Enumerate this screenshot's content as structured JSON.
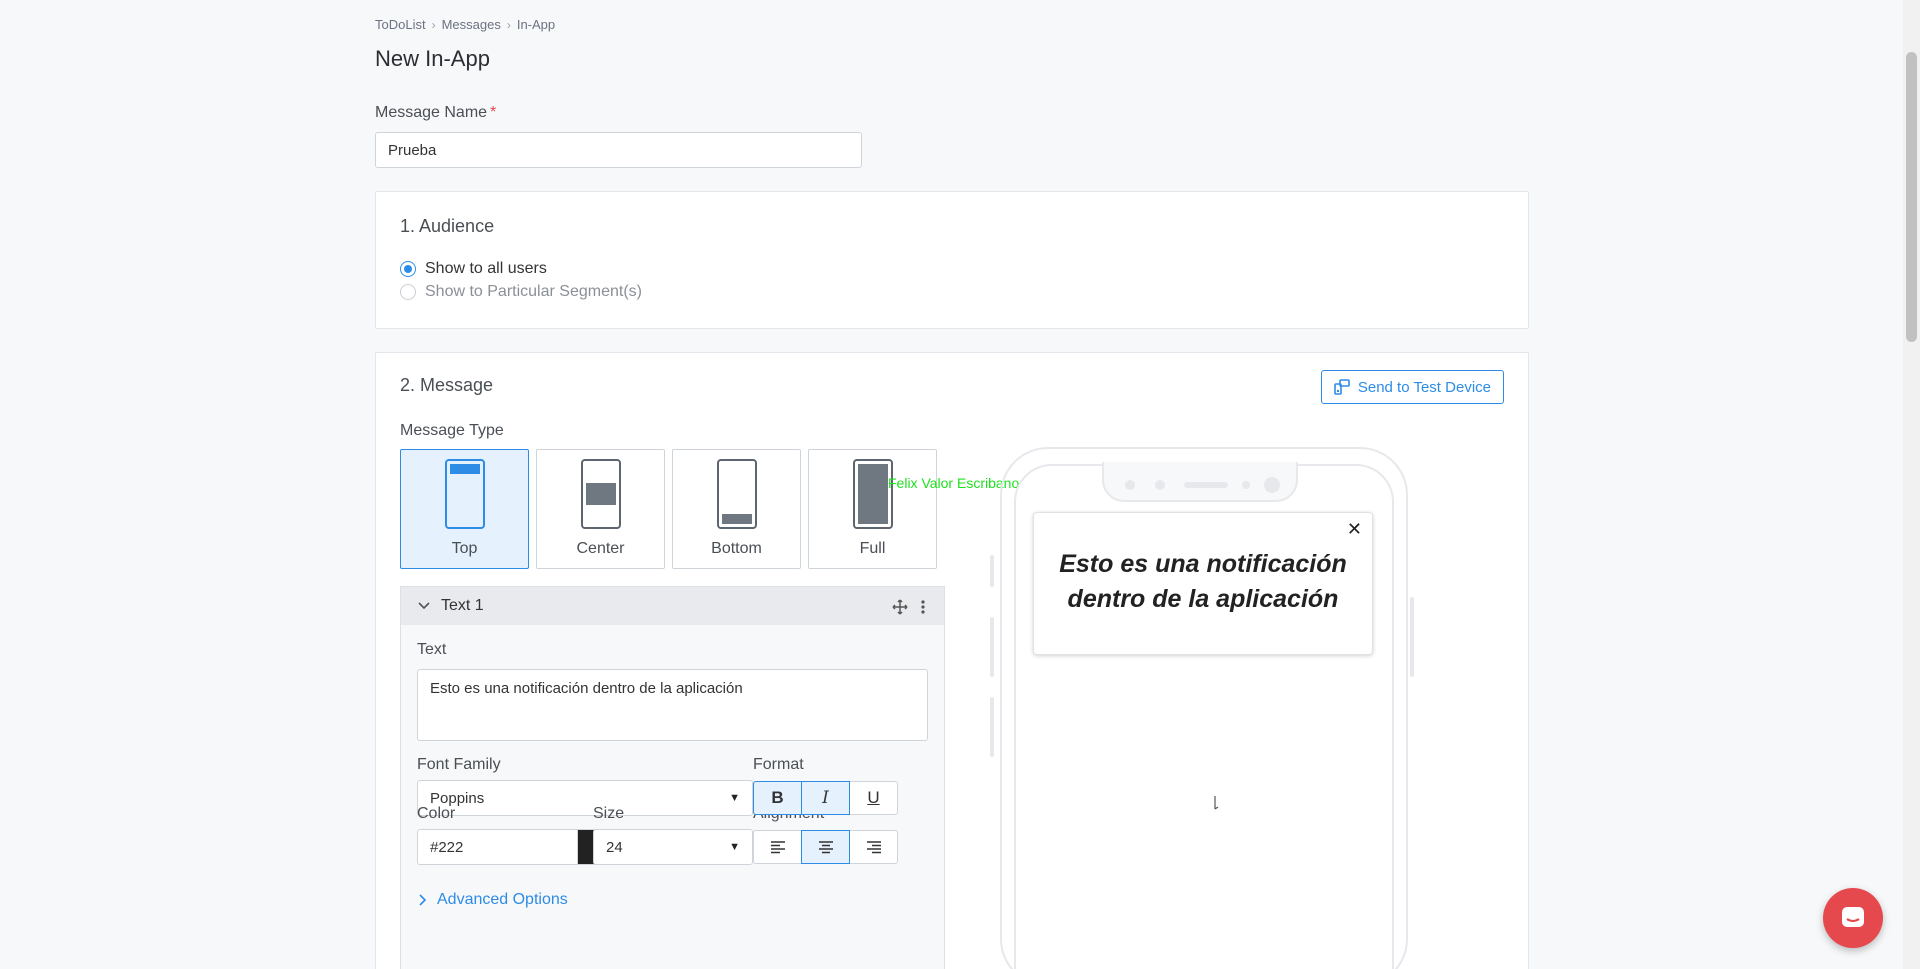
{
  "breadcrumb": {
    "items": [
      "ToDoList",
      "Messages",
      "In-App"
    ],
    "separator": "›"
  },
  "page": {
    "title": "New In-App"
  },
  "message_name": {
    "label": "Message Name",
    "required_mark": "*",
    "value": "Prueba"
  },
  "audience": {
    "title": "1. Audience",
    "options": [
      {
        "label": "Show to all users",
        "selected": true
      },
      {
        "label": "Show to Particular Segment(s)",
        "selected": false
      }
    ]
  },
  "message": {
    "title": "2. Message",
    "send_test_label": "Send to Test Device",
    "type_label": "Message Type",
    "types": [
      {
        "label": "Top",
        "selected": true
      },
      {
        "label": "Center",
        "selected": false
      },
      {
        "label": "Bottom",
        "selected": false
      },
      {
        "label": "Full",
        "selected": false
      }
    ],
    "block": {
      "title": "Text 1",
      "text_label": "Text",
      "text_value": "Esto es una notificación dentro de la aplicación",
      "font_family_label": "Font Family",
      "font_family_value": "Poppins",
      "format_label": "Format",
      "format_buttons": [
        {
          "glyph": "B",
          "active": true
        },
        {
          "glyph": "I",
          "active": true
        },
        {
          "glyph": "U",
          "active": false
        }
      ],
      "color_label": "Color",
      "color_value": "#222",
      "color_swatch": "#222222",
      "size_label": "Size",
      "size_value": "24",
      "alignment_label": "Alignment",
      "alignment_active": "center",
      "advanced_label": "Advanced Options"
    }
  },
  "watermark": "Felix Valor Escribano",
  "preview": {
    "notification_text": "Esto es una notificación dentro de la aplicación",
    "close_glyph": "✕"
  },
  "colors": {
    "accent": "#2d8ce6",
    "chat": "#e5484d",
    "watermark": "#1fe01f"
  }
}
